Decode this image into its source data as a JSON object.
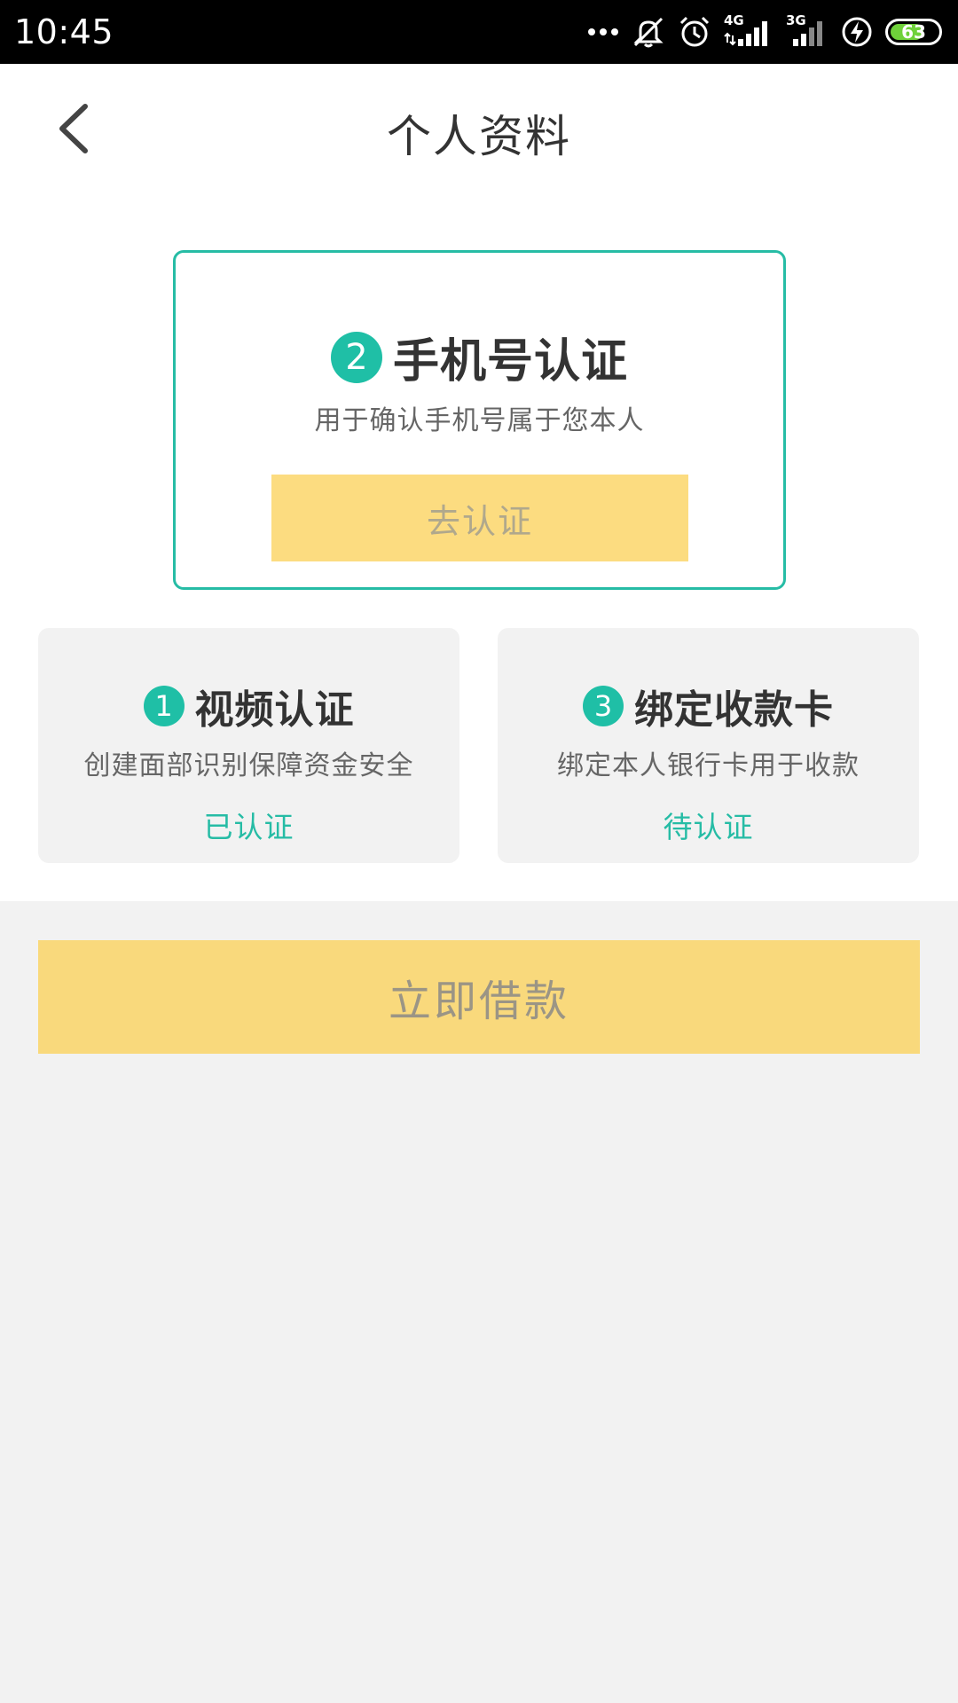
{
  "status_bar": {
    "time": "10:45",
    "network_1": "4G",
    "network_2": "3G",
    "battery": "63",
    "icons": [
      "more-dots-icon",
      "bell-off-icon",
      "alarm-icon",
      "signal-4g-icon",
      "signal-3g-icon",
      "charging-icon",
      "battery-icon"
    ]
  },
  "header": {
    "title": "个人资料",
    "back_icon": "chevron-left-icon"
  },
  "main_card": {
    "step_number": "2",
    "title": "手机号认证",
    "description": "用于确认手机号属于您本人",
    "button_label": "去认证"
  },
  "cards": [
    {
      "step_number": "1",
      "title": "视频认证",
      "description": "创建面部识别保障资金安全",
      "status": "已认证"
    },
    {
      "step_number": "3",
      "title": "绑定收款卡",
      "description": "绑定本人银行卡用于收款",
      "status": "待认证"
    }
  ],
  "borrow_button": {
    "label": "立即借款"
  },
  "colors": {
    "accent_teal": "#26bca5",
    "button_yellow": "#fcdc80",
    "background": "#f2f2f2"
  }
}
